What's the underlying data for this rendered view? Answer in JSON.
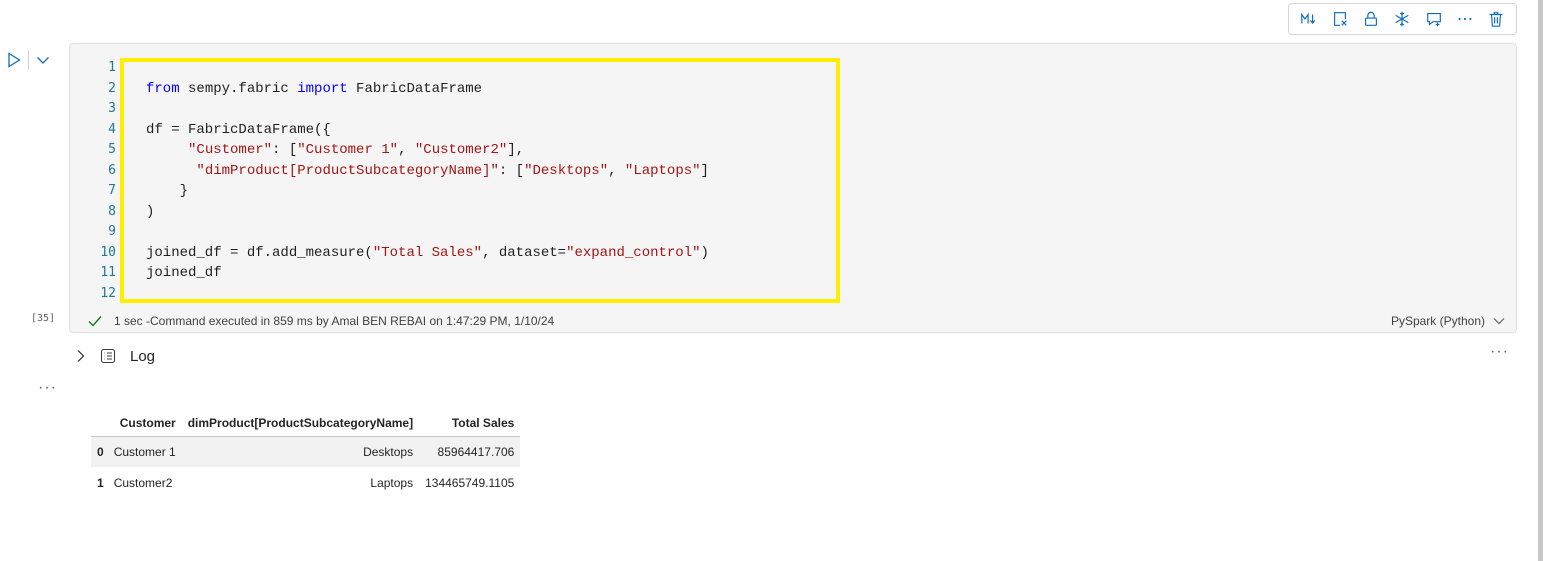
{
  "toolbar": {
    "buttons": [
      {
        "name": "markdown-toggle",
        "icon": "markdown-icon"
      },
      {
        "name": "clear-output",
        "icon": "clear-output-icon"
      },
      {
        "name": "lock-cell",
        "icon": "lock-icon"
      },
      {
        "name": "freeze-cell",
        "icon": "snowflake-icon"
      },
      {
        "name": "add-comment",
        "icon": "comment-add-icon"
      },
      {
        "name": "more-commands",
        "icon": "more-icon"
      },
      {
        "name": "delete-cell",
        "icon": "trash-icon"
      }
    ]
  },
  "cell": {
    "line_numbers": [
      "1",
      "2",
      "3",
      "4",
      "5",
      "6",
      "7",
      "8",
      "9",
      "10",
      "11",
      "12"
    ],
    "code_lines": [
      [],
      [
        {
          "t": "from",
          "c": "kw"
        },
        {
          "t": " sempy.fabric "
        },
        {
          "t": "import",
          "c": "kw"
        },
        {
          "t": " FabricDataFrame"
        }
      ],
      [],
      [
        {
          "t": "df = FabricDataFrame({"
        }
      ],
      [
        {
          "t": "     "
        },
        {
          "t": "\"Customer\"",
          "c": "str"
        },
        {
          "t": ": ["
        },
        {
          "t": "\"Customer 1\"",
          "c": "str"
        },
        {
          "t": ", "
        },
        {
          "t": "\"Customer2\"",
          "c": "str"
        },
        {
          "t": "],"
        }
      ],
      [
        {
          "t": "      "
        },
        {
          "t": "\"dimProduct[ProductSubcategoryName]\"",
          "c": "str"
        },
        {
          "t": ": ["
        },
        {
          "t": "\"Desktops\"",
          "c": "str"
        },
        {
          "t": ", "
        },
        {
          "t": "\"Laptops\"",
          "c": "str"
        },
        {
          "t": "]"
        }
      ],
      [
        {
          "t": "    }"
        }
      ],
      [
        {
          "t": ")"
        }
      ],
      [],
      [
        {
          "t": "joined_df = df.add_measure("
        },
        {
          "t": "\"Total Sales\"",
          "c": "str"
        },
        {
          "t": ", dataset="
        },
        {
          "t": "\"expand_control\"",
          "c": "str"
        },
        {
          "t": ")"
        }
      ],
      [
        {
          "t": "joined_df"
        }
      ],
      []
    ],
    "exec_count": "[35]",
    "status": "1 sec -Command executed in 859 ms by Amal BEN REBAI on 1:47:29 PM, 1/10/24",
    "language": "PySpark (Python)",
    "highlight_color": "#ffee00"
  },
  "log": {
    "label": "Log",
    "more": "···"
  },
  "output": {
    "more": "···",
    "table": {
      "columns": [
        "",
        "Customer",
        "dimProduct[ProductSubcategoryName]",
        "Total Sales"
      ],
      "rows": [
        [
          "0",
          "Customer 1",
          "Desktops",
          "85964417.706"
        ],
        [
          "1",
          "Customer2",
          "Laptops",
          "134465749.1105"
        ]
      ]
    }
  }
}
